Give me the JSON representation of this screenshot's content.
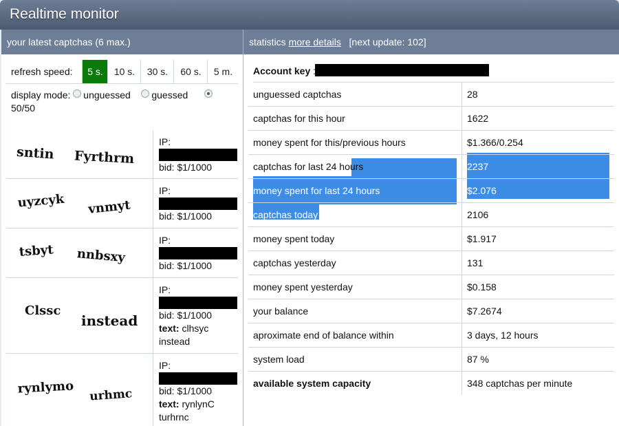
{
  "window": {
    "title": "Realtime monitor"
  },
  "left_panel": {
    "header": "your latest captchas (6 max.)",
    "refresh_label": "refresh speed:",
    "speed_options": [
      "5 s.",
      "10 s.",
      "30 s.",
      "60 s.",
      "5 m."
    ],
    "speed_selected": "5 s.",
    "display_mode_label": "display mode:",
    "mode_options": [
      "unguessed",
      "guessed",
      "50/50"
    ],
    "mode_selected": "50/50",
    "captchas": [
      {
        "word1": "sntin",
        "word2": "Fyrthrm",
        "ip_label": "IP:",
        "bid": "bid: $1/1000"
      },
      {
        "word1": "uyzcyk",
        "word2": "vnmyt",
        "ip_label": "IP:",
        "bid": "bid: $1/1000"
      },
      {
        "word1": "tsbyt",
        "word2": "nnbsxy",
        "ip_label": "IP:",
        "bid": "bid: $1/1000"
      },
      {
        "word1": "Clssc",
        "word2": "instead",
        "ip_label": "IP:",
        "bid": "bid: $1/1000",
        "text_label": "text:",
        "text_value": "clhsyc instead"
      },
      {
        "word1": "rynlymo",
        "word2": "urhmc",
        "ip_label": "IP:",
        "bid": "bid: $1/1000",
        "text_label": "text:",
        "text_value": "rynlynC turhrnc"
      }
    ]
  },
  "right_panel": {
    "header_prefix": "statistics",
    "more_details_link": "more details",
    "next_update": "[next update: 102]",
    "account_key_label": "Account key",
    "rows": [
      {
        "key": "unguessed captchas",
        "value": "28"
      },
      {
        "key": "captchas for this hour",
        "value": "1622"
      },
      {
        "key": "money spent for this/previous hours",
        "value": "$1.366/0.254"
      },
      {
        "key": "captchas for last 24 hours",
        "value": "2237"
      },
      {
        "key": "money spent for last 24 hours",
        "value": "$2.076"
      },
      {
        "key": "captchas today",
        "value": "2106"
      },
      {
        "key": "money spent today",
        "value": "$1.917"
      },
      {
        "key": "captchas yesterday",
        "value": "131"
      },
      {
        "key": "money spent yesterday",
        "value": "$0.158"
      },
      {
        "key": "your balance",
        "value": "$7.2674"
      },
      {
        "key": "aproximate end of balance within",
        "value": "3 days, 12 hours"
      },
      {
        "key": "system load",
        "value": "87 %"
      },
      {
        "key": "available system capacity",
        "value": "348 captchas per minute"
      }
    ]
  },
  "colors": {
    "selection": "#3d8de6",
    "active_speed": "#0a7a0a",
    "header": "#6e7e97"
  }
}
